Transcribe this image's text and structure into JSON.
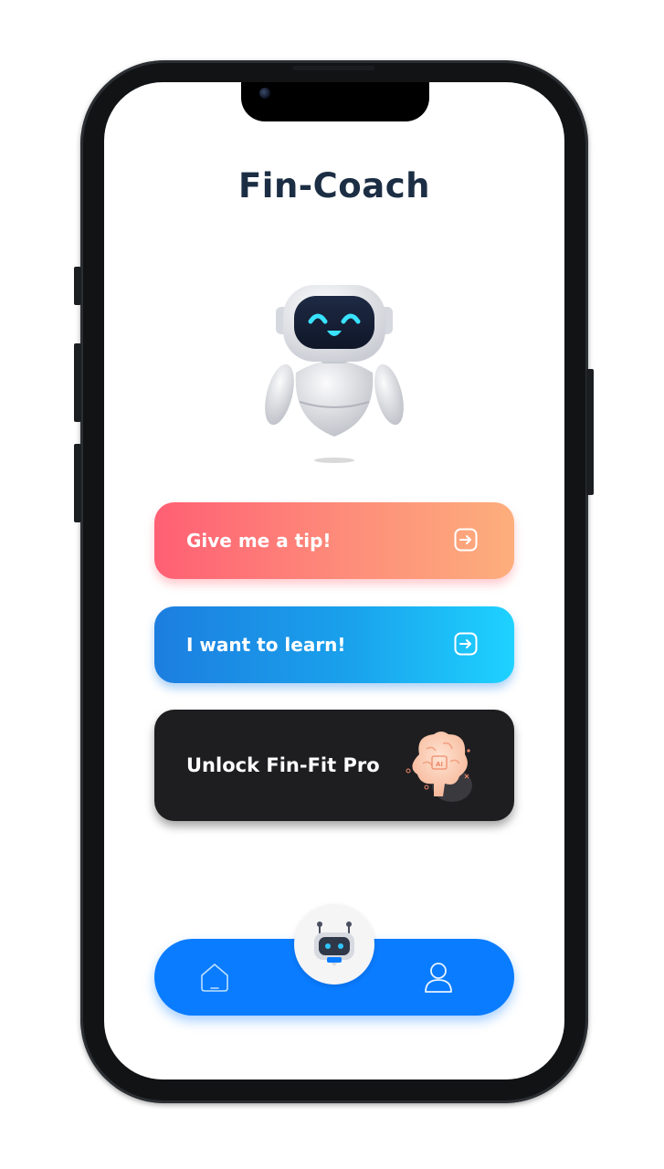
{
  "app": {
    "title": "Fin-Coach"
  },
  "actions": [
    {
      "label": "Give me a tip!",
      "icon": "arrow-right-square-icon"
    },
    {
      "label": "I want to learn!",
      "icon": "arrow-right-square-icon"
    },
    {
      "label": "Unlock Fin-Fit Pro",
      "icon": "ai-brain-icon",
      "badge_text": "AI"
    }
  ],
  "bottom_nav": {
    "items": [
      {
        "icon": "home-icon"
      },
      {
        "icon": "chatbot-icon"
      },
      {
        "icon": "profile-icon"
      }
    ]
  },
  "colors": {
    "title": "#1c2e44",
    "tip_gradient_start": "#ff5f74",
    "tip_gradient_end": "#fdae7c",
    "learn_gradient_start": "#1c7ee0",
    "learn_gradient_end": "#1ed2ff",
    "pro_background": "#1e1e21",
    "nav_background": "#0a7cff"
  }
}
